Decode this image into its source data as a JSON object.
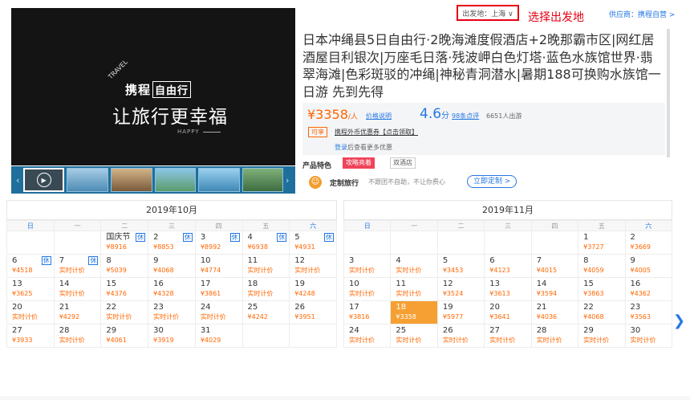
{
  "header": {
    "departure_label": "出发地：上海 ∨",
    "departure_note": "选择出发地",
    "supplier": "供应商：携程自营 >"
  },
  "media": {
    "video_tag": "TRAVEL",
    "logo_text": "携程",
    "logo_box": "自由行",
    "slogan": "让旅行更幸福",
    "happy": "HAPPY",
    "thumb_count": 6
  },
  "product": {
    "title": "日本冲绳县5日自由行·2晚海滩度假酒店+2晚那霸市区|网红居酒屋目利银次|万座毛日落·残波岬白色灯塔·蓝色水族馆世界·翡翠海滩|色彩斑驳的冲绳|神秘青洞潜水|暑期188可换购水族馆一日游 先到先得",
    "price": "¥3358",
    "price_unit": "/人",
    "price_note": "价格说明",
    "score": "4.6",
    "score_unit": "分",
    "reviews": "98条点评",
    "people": "6651人出游",
    "coupon_badge": "可享",
    "coupon_text": "携程外币优惠券【点击领取】",
    "login_link": "登录",
    "login_rest": "后查看更多优惠",
    "features_label": "产品特色",
    "feature_1": "攻略亮着",
    "feature_2": "双酒店",
    "custom_label": "定制旅行",
    "custom_desc": "不跟团不自助，不让你费心",
    "custom_btn": "立即定制 >"
  },
  "calendars": [
    {
      "title": "2019年10月",
      "weekdays": [
        "日",
        "一",
        "二",
        "三",
        "四",
        "五",
        "六"
      ],
      "weeks": [
        [
          null,
          null,
          {
            "d": "国庆节",
            "p": "¥8916",
            "hol": "休"
          },
          {
            "d": "2",
            "p": "¥8853",
            "hol": "休"
          },
          {
            "d": "3",
            "p": "¥8992",
            "hol": "休"
          },
          {
            "d": "4",
            "p": "¥6938",
            "hol": "休"
          },
          {
            "d": "5",
            "p": "¥4931",
            "hol": "休"
          }
        ],
        [
          {
            "d": "6",
            "p": "¥4518",
            "hol": "休"
          },
          {
            "d": "7",
            "p": "实时计价",
            "hol": "休"
          },
          {
            "d": "8",
            "p": "¥5039"
          },
          {
            "d": "9",
            "p": "¥4068"
          },
          {
            "d": "10",
            "p": "¥4774"
          },
          {
            "d": "11",
            "p": "实时计价"
          },
          {
            "d": "12",
            "p": "实时计价"
          }
        ],
        [
          {
            "d": "13",
            "p": "¥3625"
          },
          {
            "d": "14",
            "p": "实时计价"
          },
          {
            "d": "15",
            "p": "¥4376"
          },
          {
            "d": "16",
            "p": "¥4328"
          },
          {
            "d": "17",
            "p": "¥3861"
          },
          {
            "d": "18",
            "p": "实时计价"
          },
          {
            "d": "19",
            "p": "¥4248"
          }
        ],
        [
          {
            "d": "20",
            "p": "实时计价"
          },
          {
            "d": "21",
            "p": "¥4292"
          },
          {
            "d": "22",
            "p": "实时计价"
          },
          {
            "d": "23",
            "p": "实时计价"
          },
          {
            "d": "24",
            "p": "实时计价"
          },
          {
            "d": "25",
            "p": "¥4242"
          },
          {
            "d": "26",
            "p": "¥3951"
          }
        ],
        [
          {
            "d": "27",
            "p": "¥3933"
          },
          {
            "d": "28",
            "p": "实时计价"
          },
          {
            "d": "29",
            "p": "¥4061"
          },
          {
            "d": "30",
            "p": "¥3919"
          },
          {
            "d": "31",
            "p": "¥4029"
          },
          null,
          null
        ]
      ]
    },
    {
      "title": "2019年11月",
      "weekdays": [
        "日",
        "一",
        "二",
        "三",
        "四",
        "五",
        "六"
      ],
      "weeks": [
        [
          null,
          null,
          null,
          null,
          null,
          {
            "d": "1",
            "p": "¥3727"
          },
          {
            "d": "2",
            "p": "¥3669"
          }
        ],
        [
          {
            "d": "3",
            "p": "实时计价"
          },
          {
            "d": "4",
            "p": "实时计价"
          },
          {
            "d": "5",
            "p": "¥3453"
          },
          {
            "d": "6",
            "p": "¥4123"
          },
          {
            "d": "7",
            "p": "¥4015"
          },
          {
            "d": "8",
            "p": "¥4059"
          },
          {
            "d": "9",
            "p": "¥4005"
          }
        ],
        [
          {
            "d": "10",
            "p": "实时计价"
          },
          {
            "d": "11",
            "p": "实时计价"
          },
          {
            "d": "12",
            "p": "¥3524"
          },
          {
            "d": "13",
            "p": "¥3613"
          },
          {
            "d": "14",
            "p": "¥3594"
          },
          {
            "d": "15",
            "p": "¥3863"
          },
          {
            "d": "16",
            "p": "¥4362"
          }
        ],
        [
          {
            "d": "17",
            "p": "¥3816"
          },
          {
            "d": "18",
            "p": "¥3358",
            "sel": true
          },
          {
            "d": "19",
            "p": "¥5977"
          },
          {
            "d": "20",
            "p": "¥3641"
          },
          {
            "d": "21",
            "p": "¥4036"
          },
          {
            "d": "22",
            "p": "¥4068"
          },
          {
            "d": "23",
            "p": "¥3563"
          }
        ],
        [
          {
            "d": "24",
            "p": "实时计价"
          },
          {
            "d": "25",
            "p": "实时计价"
          },
          {
            "d": "26",
            "p": "实时计价"
          },
          {
            "d": "27",
            "p": "实时计价"
          },
          {
            "d": "28",
            "p": "实时计价"
          },
          {
            "d": "29",
            "p": "实时计价"
          },
          {
            "d": "30",
            "p": "实时计价"
          }
        ]
      ]
    }
  ],
  "nav": {
    "next_icon": "chevron-right-icon",
    "next_glyph": "❯"
  },
  "colors": {
    "accent": "#f60",
    "link": "#2577e3",
    "highlight": "#e60012",
    "selected": "#f6a033"
  }
}
